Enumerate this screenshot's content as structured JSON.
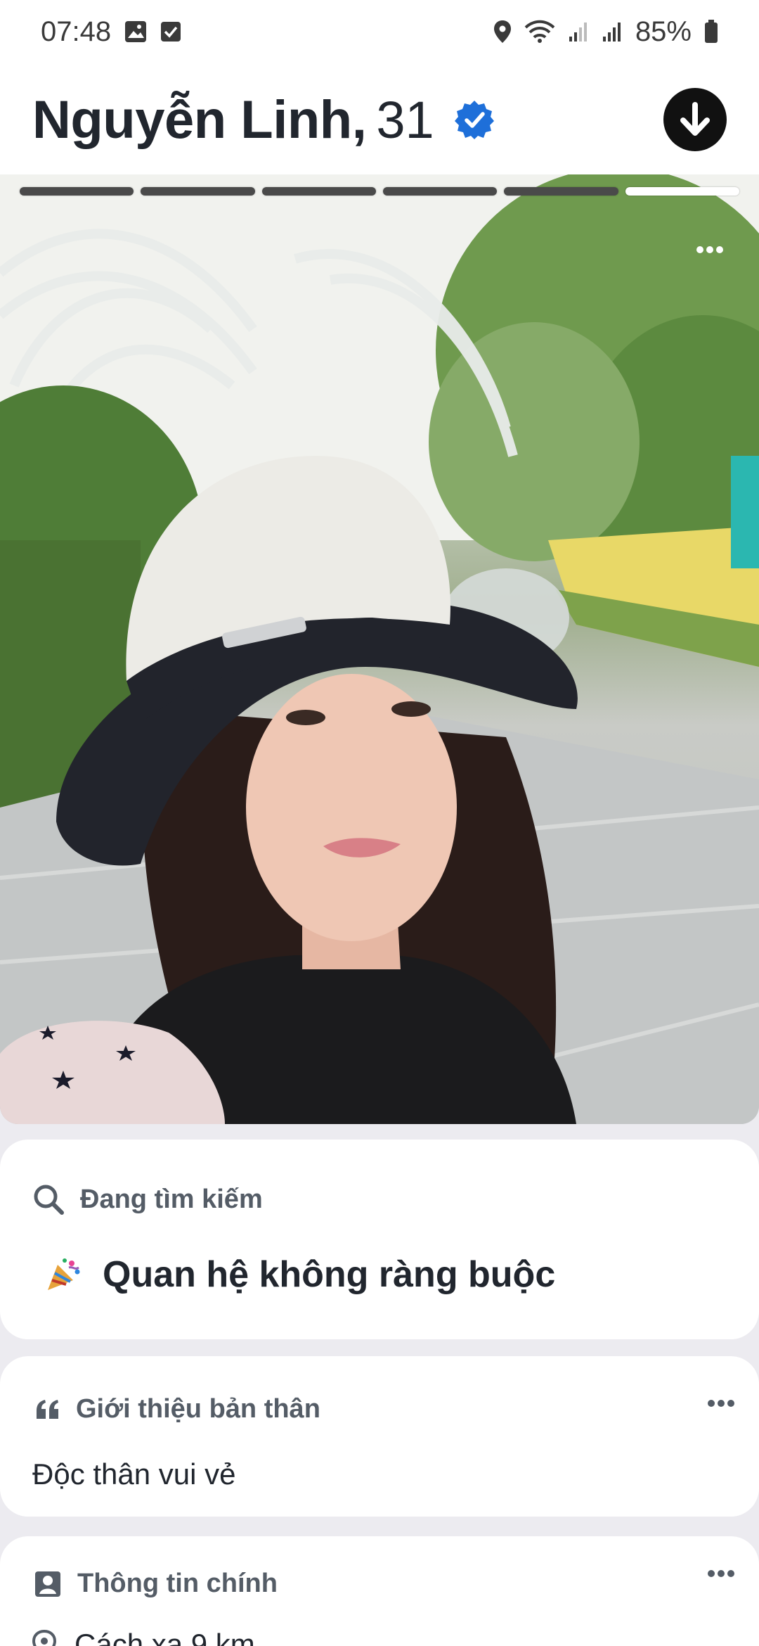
{
  "status_bar": {
    "time": "07:48",
    "battery": "85%",
    "icons": [
      "gallery-icon",
      "checkbox-icon",
      "location-icon",
      "wifi-icon",
      "signal-icon",
      "signal-icon",
      "battery-icon"
    ]
  },
  "profile": {
    "name": "Nguyễn Linh,",
    "age": "31",
    "verified": true,
    "verified_icon": "verified-badge-icon",
    "collapse_icon": "arrow-down-icon"
  },
  "photo": {
    "total": 6,
    "current": 6,
    "more_icon": "more-horizontal-icon"
  },
  "looking_for": {
    "label": "Đang tìm kiếm",
    "icon": "search-icon",
    "value_emoji": "🎉",
    "value": "Quan hệ không ràng buộc"
  },
  "about": {
    "label": "Giới thiệu bản thân",
    "icon": "quote-icon",
    "text": "Độc thân vui vẻ"
  },
  "basics": {
    "label": "Thông tin chính",
    "icon": "profile-card-icon",
    "distance": "Cách xa 9 km",
    "distance_icon": "location-pin-icon"
  },
  "colors": {
    "verified_blue": "#1e6fd9",
    "progress_active": "#ffffff",
    "progress_inactive": "#4a4a4a",
    "text_primary": "#21262e",
    "text_secondary": "#545c66",
    "background": "#ecebf0"
  }
}
